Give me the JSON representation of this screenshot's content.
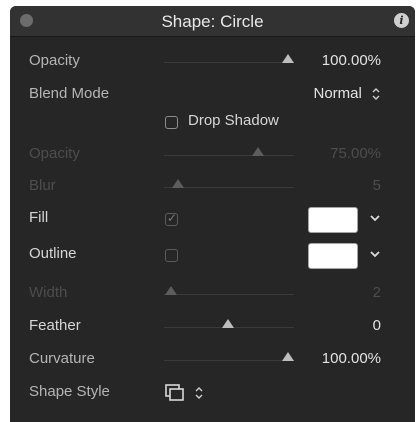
{
  "header": {
    "title": "Shape: Circle"
  },
  "rows": {
    "opacity": {
      "label": "Opacity",
      "value": "100.00%",
      "level": 1.0
    },
    "blend_mode": {
      "label": "Blend Mode",
      "value": "Normal"
    },
    "drop_shadow": {
      "label": "Drop Shadow",
      "checked": false
    },
    "shadow_opacity": {
      "label": "Opacity",
      "value": "75.00%",
      "level": 0.75
    },
    "blur": {
      "label": "Blur",
      "value": "5",
      "level": 0.05
    },
    "fill": {
      "label": "Fill",
      "checked": true,
      "color": "#ffffff"
    },
    "outline": {
      "label": "Outline",
      "checked": false,
      "color": "#ffffff"
    },
    "width": {
      "label": "Width",
      "value": "2",
      "level": 0.02
    },
    "feather": {
      "label": "Feather",
      "value": "0",
      "level": 0.5
    },
    "curvature": {
      "label": "Curvature",
      "value": "100.00%",
      "level": 1.0
    },
    "shape_style": {
      "label": "Shape Style",
      "icon": "shape-style-icon"
    }
  },
  "colors": {
    "panel": "#262626",
    "titlebar": "#323232",
    "text": "#e3e3e3",
    "dim_text": "#4d4d4d"
  }
}
